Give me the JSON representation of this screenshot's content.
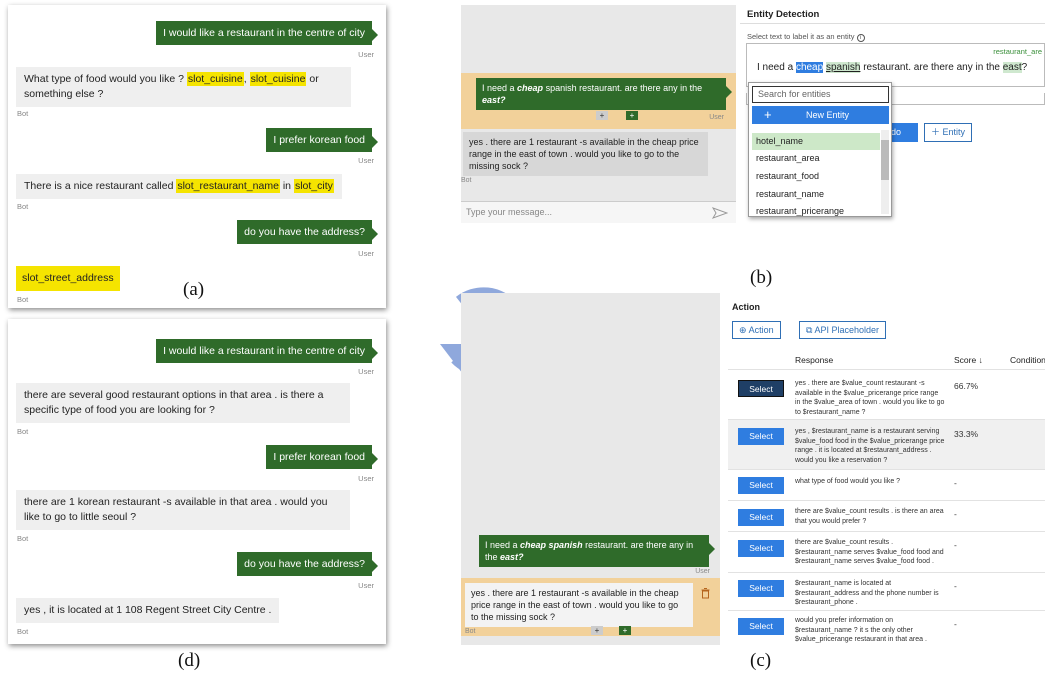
{
  "panel_a": {
    "u1": "I would like a restaurant in the centre of city",
    "u1_label": "User",
    "b1_pre": "What type of food would you like ?",
    "b1_slot1": "slot_cuisine",
    "b1_comma": ",",
    "b1_slot2": "slot_cuisine",
    "b1_or": "or",
    "b1_post": "something else ?",
    "b1_label": "Bot",
    "u2": "I prefer korean food",
    "u2_label": "User",
    "b2_pre": "There is a nice restaurant called",
    "b2_slot1": "slot_restaurant_name",
    "b2_in": "in",
    "b2_slot2": "slot_city",
    "b2_label": "Bot",
    "u3": "do you have the address?",
    "u3_label": "User",
    "b3_slot": "slot_street_address",
    "b3_label": "Bot",
    "caption": "(a)"
  },
  "panel_b": {
    "chat_msg_pre": "I need a",
    "chat_msg_bold": "cheap",
    "chat_msg_mid": "spanish restaurant. are there any in the",
    "chat_msg_bold2": "east?",
    "bot_reply": "yes . there are 1 restaurant -s available in the cheap price range in the east of town . would you like to go to the missing sock ?",
    "bot_label": "Bot",
    "user_label": "User",
    "input_placeholder": "Type your message...",
    "title": "Entity Detection",
    "instruction": "Select text to label it as an entity",
    "tag_label": "restaurant_are",
    "sent_pre": "I need a",
    "sent_sel": "cheap",
    "sent_ent": "spanish",
    "sent_mid": "restaurant. are there any in the",
    "sent_ent2": "east",
    "sent_end": "?",
    "search_placeholder": "Search for entities",
    "new_entity": "New Entity",
    "items": [
      "hotel_name",
      "restaurant_area",
      "restaurant_food",
      "restaurant_name",
      "restaurant_pricerange"
    ],
    "undo_label": "ndo",
    "entity_btn": "Entity",
    "caption": "(b)"
  },
  "panel_c": {
    "chat_msg_pre": "I need a",
    "chat_msg_bold": "cheap spanish",
    "chat_msg_mid": "restaurant. are there any in the",
    "chat_msg_bold2": "east?",
    "user_label": "User",
    "bot_reply": "yes . there are 1 restaurant -s available in the cheap price range in the east of town . would you like to go to the missing sock ?",
    "bot_label": "Bot",
    "title": "Action",
    "add_action": "Action",
    "api_placeholder": "API Placeholder",
    "col_response": "Response",
    "col_score": "Score ↓",
    "col_condition": "Condition",
    "select_label": "Select",
    "rows": [
      {
        "response": "yes . there are $value_count restaurant -s available in the $value_pricerange price range in the $value_area of town . would you like to go to $restaurant_name ?",
        "score": "66.7%"
      },
      {
        "response": "yes , $restaurant_name is a restaurant serving $value_food food in the $value_pricerange price range . it is located at $restaurant_address . would you like a reservation ?",
        "score": "33.3%"
      },
      {
        "response": "what type of food would you like ?",
        "score": "-"
      },
      {
        "response": "there are $value_count results . is there an area that you would prefer ?",
        "score": "-"
      },
      {
        "response": "there are $value_count results . $restaurant_name serves $value_food food and $restaurant_name serves $value_food food .",
        "score": "-"
      },
      {
        "response": "$restaurant_name is located at $restaurant_address and the phone number is $restaurant_phone .",
        "score": "-"
      },
      {
        "response": "would you prefer information on $restaurant_name ? it s the only other $value_pricerange restaurant in that area .",
        "score": "-"
      }
    ],
    "caption": "(c)"
  },
  "panel_d": {
    "u1": "I would like a restaurant in the centre of city",
    "u1_label": "User",
    "b1": "there are several good restaurant options in that area . is there a specific type of food you are looking for ?",
    "b1_label": "Bot",
    "u2": "I prefer korean food",
    "u2_label": "User",
    "b2": "there are 1 korean restaurant -s available in that area . would you like to go to little seoul ?",
    "b2_label": "Bot",
    "u3": "do you have the address?",
    "u3_label": "User",
    "b3": "yes , it is located at 1 108 Regent Street City Centre .",
    "b3_label": "Bot",
    "caption": "(d)"
  },
  "colors": {
    "user_bubble": "#2f6b2a",
    "slot_highlight": "#f5e400",
    "accent_blue": "#2f7de0",
    "cycle_arrow": "#8fa8dc"
  }
}
